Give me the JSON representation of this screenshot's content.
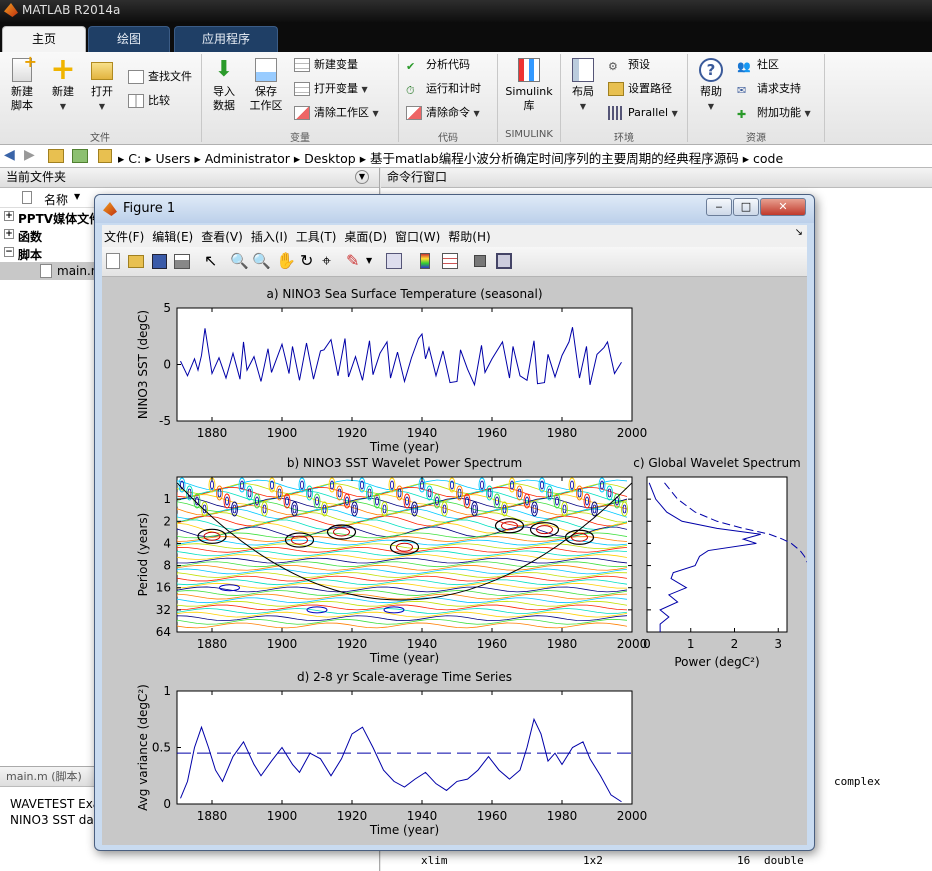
{
  "app": {
    "title": "MATLAB R2014a"
  },
  "tabs": [
    "主页",
    "绘图",
    "应用程序"
  ],
  "ribbon": {
    "file": {
      "new_script": "新建\n脚本",
      "new": "新建",
      "open": "打开",
      "find_files": "查找文件",
      "compare": "比较",
      "label": "文件"
    },
    "variable": {
      "import": "导入\n数据",
      "save_ws": "保存\n工作区",
      "new_var": "新建变量",
      "open_var": "打开变量",
      "clear_ws": "清除工作区",
      "label": "变量"
    },
    "code": {
      "analyze": "分析代码",
      "run_time": "运行和计时",
      "clear_cmd": "清除命令",
      "label": "代码"
    },
    "simulink": {
      "lib": "Simulink\n库",
      "label": "SIMULINK"
    },
    "env": {
      "layout": "布局",
      "prefs": "预设",
      "set_path": "设置路径",
      "parallel": "Parallel",
      "label": "环境"
    },
    "resources": {
      "help": "帮助",
      "community": "社区",
      "support": "请求支持",
      "addons": "附加功能",
      "label": "资源"
    }
  },
  "path": {
    "segments": [
      "C:",
      "Users",
      "Administrator",
      "Desktop",
      "基于matlab编程小波分析确定时间序列的主要周期的经典程序源码",
      "code"
    ]
  },
  "left_panel": {
    "title": "当前文件夹",
    "col_name": "名称",
    "items": [
      "PPTV媒体文件",
      "函数",
      "脚本",
      "main.m"
    ],
    "details_title": "main.m (脚本)",
    "details_lines": [
      "WAVETEST Exa",
      "NINO3 SST da"
    ]
  },
  "cmd": {
    "title": "命令行窗口",
    "lines": [
      {
        "name": "",
        "size": "",
        "bytes": "",
        "cls": "complex"
      },
      {
        "name": "xlim",
        "size": "1x2",
        "bytes": "16",
        "cls": "double"
      }
    ]
  },
  "figure": {
    "title": "Figure 1",
    "menus": [
      "文件(F)",
      "编辑(E)",
      "查看(V)",
      "插入(I)",
      "工具(T)",
      "桌面(D)",
      "窗口(W)",
      "帮助(H)"
    ]
  },
  "chart_data": [
    {
      "type": "line",
      "title": "a) NINO3 Sea Surface Temperature (seasonal)",
      "xlabel": "Time (year)",
      "ylabel": "NINO3 SST (degC)",
      "xlim": [
        1870,
        2000
      ],
      "ylim": [
        -5,
        5
      ],
      "xticks": [
        1880,
        1900,
        1920,
        1940,
        1960,
        1980,
        2000
      ],
      "yticks": [
        -5,
        0,
        5
      ],
      "series": [
        {
          "x": [
            1871,
            1873,
            1875,
            1876,
            1877,
            1878,
            1880,
            1882,
            1884,
            1886,
            1888,
            1889,
            1890,
            1892,
            1894,
            1896,
            1897,
            1900,
            1902,
            1903,
            1905,
            1907,
            1909,
            1911,
            1912,
            1914,
            1916,
            1918,
            1919,
            1921,
            1923,
            1925,
            1926,
            1928,
            1930,
            1931,
            1933,
            1935,
            1937,
            1939,
            1940,
            1941,
            1942,
            1944,
            1946,
            1948,
            1950,
            1951,
            1953,
            1955,
            1957,
            1958,
            1960,
            1963,
            1965,
            1966,
            1968,
            1970,
            1972,
            1973,
            1975,
            1976,
            1978,
            1980,
            1982,
            1983,
            1985,
            1987,
            1988,
            1990,
            1992,
            1993,
            1995,
            1997
          ],
          "y": [
            0.3,
            -1.0,
            0.5,
            -0.5,
            0.8,
            3.2,
            -0.8,
            0.6,
            -1.2,
            1.0,
            -1.3,
            2.0,
            -0.5,
            0.7,
            -1.5,
            1.4,
            -0.7,
            1.8,
            -0.8,
            1.6,
            -1.4,
            1.9,
            -1.3,
            1.2,
            1.3,
            2.2,
            -1.0,
            2.3,
            -1.1,
            0.7,
            -1.4,
            2.1,
            -0.9,
            1.0,
            2.0,
            -1.2,
            1.1,
            -1.5,
            0.6,
            2.3,
            2.7,
            0.5,
            1.5,
            -1.0,
            1.2,
            -1.6,
            -1.5,
            1.3,
            -0.4,
            -1.8,
            1.7,
            -0.7,
            0.5,
            2.0,
            -1.2,
            1.6,
            -1.0,
            -1.4,
            2.1,
            -1.7,
            -1.6,
            0.9,
            -1.1,
            0.8,
            2.0,
            3.3,
            -1.2,
            1.6,
            -1.8,
            0.9,
            1.5,
            2.0,
            -0.8,
            0.2
          ]
        }
      ]
    },
    {
      "type": "heatmap",
      "title": "b) NINO3 SST Wavelet Power Spectrum",
      "xlabel": "Time (year)",
      "ylabel": "Period (years)",
      "xlim": [
        1870,
        2000
      ],
      "xticks": [
        1880,
        1900,
        1920,
        1940,
        1960,
        1980,
        2000
      ],
      "yticks": [
        1,
        2,
        4,
        8,
        16,
        32,
        64
      ],
      "yscale": "log2"
    },
    {
      "type": "line",
      "title": "c) Global Wavelet Spectrum",
      "xlabel": "Power (degC²)",
      "xlim": [
        0,
        3.2
      ],
      "xticks": [
        0,
        1,
        2,
        3
      ],
      "series": [
        {
          "name": "global",
          "period": [
            0.6,
            1,
            1.5,
            2,
            2.5,
            3,
            3.5,
            4,
            5,
            6,
            8,
            10,
            12,
            16,
            20,
            25,
            32,
            40,
            50,
            64
          ],
          "power": [
            0.05,
            0.2,
            0.45,
            0.8,
            1.6,
            2.6,
            2.2,
            2.5,
            1.4,
            1.2,
            1.1,
            0.6,
            0.55,
            0.9,
            0.5,
            0.7,
            0.3,
            0.5,
            0.3,
            0.3
          ]
        },
        {
          "name": "significance",
          "period": [
            0.6,
            1,
            1.5,
            2,
            2.5,
            3,
            3.5,
            4,
            5,
            6,
            8
          ],
          "power": [
            0.4,
            0.7,
            1.1,
            1.6,
            2.2,
            2.8,
            3.1,
            3.3,
            3.5,
            3.6,
            3.7
          ]
        }
      ]
    },
    {
      "type": "line",
      "title": "d) 2-8 yr Scale-average Time Series",
      "xlabel": "Time (year)",
      "ylabel": "Avg variance (degC²)",
      "xlim": [
        1870,
        2000
      ],
      "ylim": [
        0,
        1
      ],
      "xticks": [
        1880,
        1900,
        1920,
        1940,
        1960,
        1980,
        2000
      ],
      "yticks": [
        0,
        0.5,
        1
      ],
      "series": [
        {
          "name": "scale-avg",
          "x": [
            1871,
            1873,
            1875,
            1877,
            1879,
            1881,
            1883,
            1886,
            1889,
            1892,
            1894,
            1897,
            1900,
            1903,
            1905,
            1908,
            1911,
            1914,
            1917,
            1920,
            1923,
            1926,
            1929,
            1932,
            1935,
            1938,
            1941,
            1944,
            1947,
            1950,
            1953,
            1956,
            1959,
            1962,
            1965,
            1968,
            1970,
            1972,
            1974,
            1976,
            1978,
            1980,
            1983,
            1986,
            1988,
            1991,
            1994,
            1997
          ],
          "y": [
            0.05,
            0.2,
            0.5,
            0.68,
            0.5,
            0.3,
            0.2,
            0.42,
            0.55,
            0.35,
            0.25,
            0.38,
            0.5,
            0.35,
            0.28,
            0.45,
            0.4,
            0.25,
            0.4,
            0.62,
            0.68,
            0.5,
            0.3,
            0.2,
            0.15,
            0.22,
            0.28,
            0.18,
            0.12,
            0.2,
            0.22,
            0.3,
            0.42,
            0.3,
            0.22,
            0.3,
            0.5,
            0.75,
            0.62,
            0.38,
            0.45,
            0.35,
            0.5,
            0.55,
            0.4,
            0.25,
            0.08,
            0.02
          ]
        },
        {
          "name": "significance",
          "x": [
            1870,
            2000
          ],
          "y": [
            0.45,
            0.45
          ],
          "style": "dashed"
        }
      ]
    }
  ],
  "colors": {
    "line": "#0000a8",
    "bg_plot": "#ffffff",
    "figure_bg": "#c8c8c8"
  }
}
